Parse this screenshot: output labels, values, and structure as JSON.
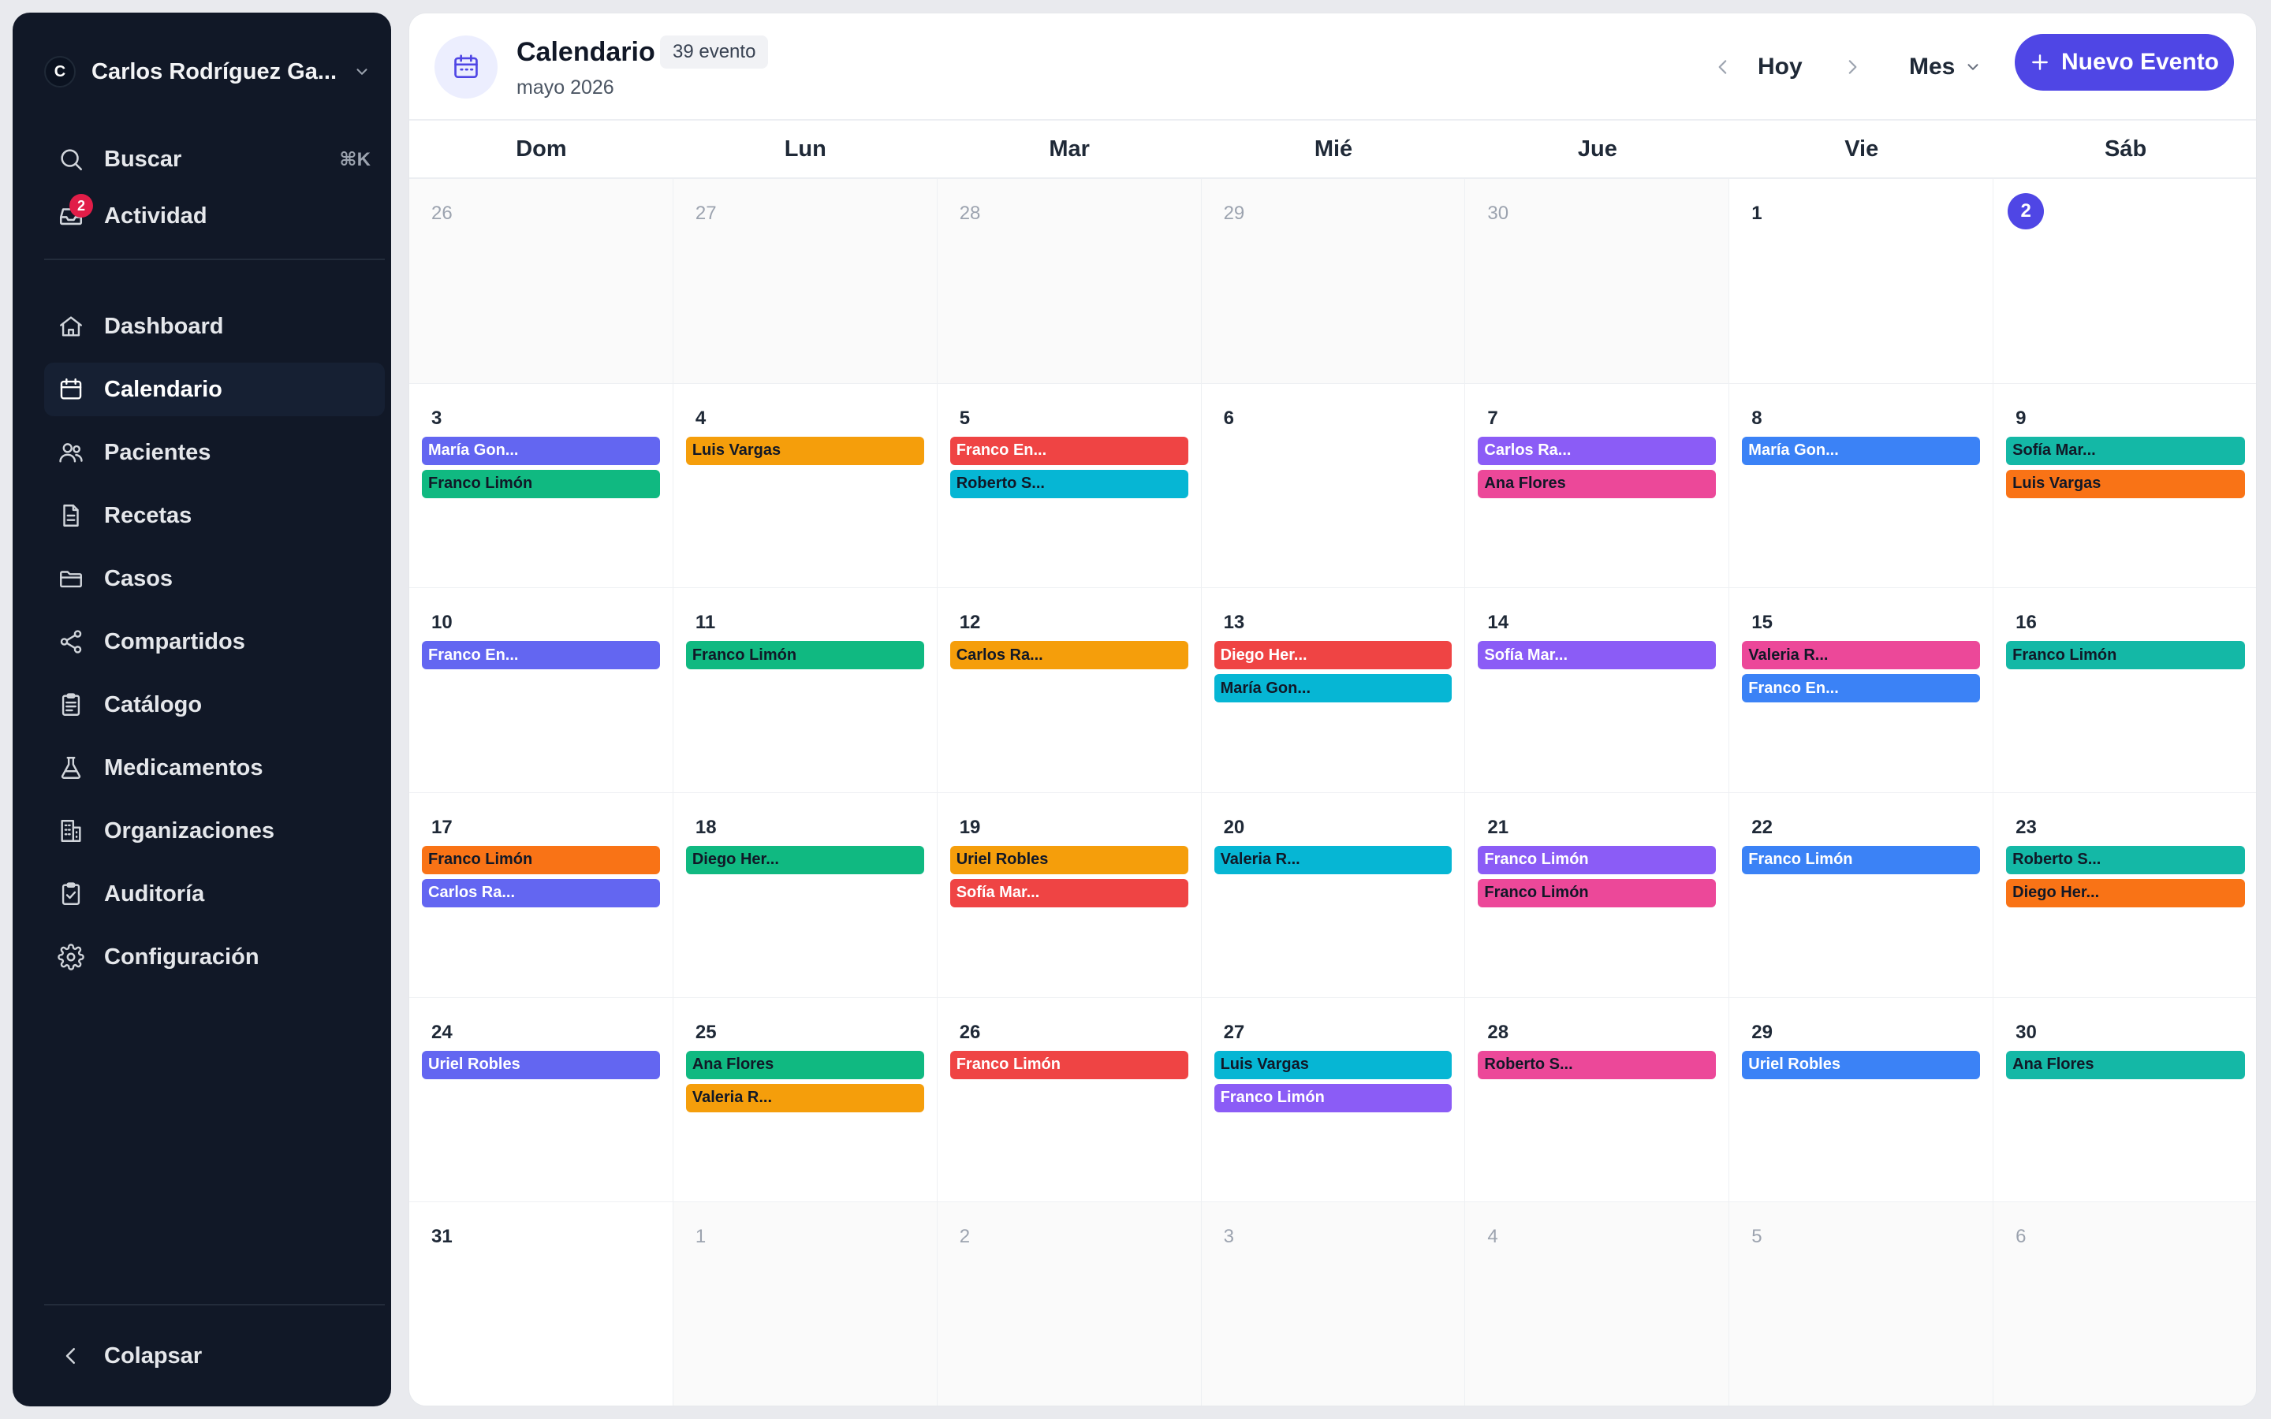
{
  "sidebar": {
    "user": {
      "initial": "C",
      "name": "Carlos Rodríguez Ga..."
    },
    "search": {
      "label": "Buscar",
      "shortcut": "⌘K"
    },
    "activity": {
      "label": "Actividad",
      "badge": "2"
    },
    "nav": [
      {
        "label": "Dashboard",
        "icon": "home-icon"
      },
      {
        "label": "Calendario",
        "icon": "calendar-icon",
        "active": true
      },
      {
        "label": "Pacientes",
        "icon": "users-icon"
      },
      {
        "label": "Recetas",
        "icon": "document-icon"
      },
      {
        "label": "Casos",
        "icon": "folder-icon"
      },
      {
        "label": "Compartidos",
        "icon": "share-icon"
      },
      {
        "label": "Catálogo",
        "icon": "clipboard-list-icon"
      },
      {
        "label": "Medicamentos",
        "icon": "flask-icon"
      },
      {
        "label": "Organizaciones",
        "icon": "building-icon"
      },
      {
        "label": "Auditoría",
        "icon": "clipboard-check-icon"
      },
      {
        "label": "Configuración",
        "icon": "gear-icon"
      }
    ],
    "collapse_label": "Colapsar"
  },
  "header": {
    "title": "Calendario",
    "count": "39 evento",
    "subtitle": "mayo 2026",
    "today_label": "Hoy",
    "view_label": "Mes",
    "new_event_label": "Nuevo Evento"
  },
  "colors": {
    "accent": "#4f46e5",
    "indigo": "#6366f1",
    "green": "#10b981",
    "amber": "#f59e0b",
    "red": "#ef4444",
    "cyan": "#06b6d4",
    "purple": "#8b5cf6",
    "blue": "#3b82f6",
    "teal": "#14b8a6",
    "orange": "#f97316",
    "pink": "#ec4899"
  },
  "weekdays": [
    "Dom",
    "Lun",
    "Mar",
    "Mié",
    "Jue",
    "Vie",
    "Sáb"
  ],
  "days": [
    {
      "num": "26",
      "other": true,
      "events": []
    },
    {
      "num": "27",
      "other": true,
      "events": []
    },
    {
      "num": "28",
      "other": true,
      "events": []
    },
    {
      "num": "29",
      "other": true,
      "events": []
    },
    {
      "num": "30",
      "other": true,
      "events": []
    },
    {
      "num": "1",
      "events": []
    },
    {
      "num": "2",
      "today": true,
      "events": []
    },
    {
      "num": "3",
      "events": [
        {
          "title": "María Gon...",
          "color": "indigo"
        },
        {
          "title": "Franco Limón",
          "color": "green"
        }
      ]
    },
    {
      "num": "4",
      "events": [
        {
          "title": "Luis Vargas",
          "color": "amber"
        }
      ]
    },
    {
      "num": "5",
      "events": [
        {
          "title": "Franco En...",
          "color": "red"
        },
        {
          "title": "Roberto S...",
          "color": "cyan"
        }
      ]
    },
    {
      "num": "6",
      "events": []
    },
    {
      "num": "7",
      "events": [
        {
          "title": "Carlos Ra...",
          "color": "purple"
        },
        {
          "title": "Ana Flores",
          "color": "pink"
        }
      ]
    },
    {
      "num": "8",
      "events": [
        {
          "title": "María Gon...",
          "color": "blue"
        }
      ]
    },
    {
      "num": "9",
      "events": [
        {
          "title": "Sofía Mar...",
          "color": "teal"
        },
        {
          "title": "Luis Vargas",
          "color": "orange"
        }
      ]
    },
    {
      "num": "10",
      "events": [
        {
          "title": "Franco En...",
          "color": "indigo"
        }
      ]
    },
    {
      "num": "11",
      "events": [
        {
          "title": "Franco Limón",
          "color": "green"
        }
      ]
    },
    {
      "num": "12",
      "events": [
        {
          "title": "Carlos Ra...",
          "color": "amber"
        }
      ]
    },
    {
      "num": "13",
      "events": [
        {
          "title": "Diego Her...",
          "color": "red"
        },
        {
          "title": "María Gon...",
          "color": "cyan"
        }
      ]
    },
    {
      "num": "14",
      "events": [
        {
          "title": "Sofía Mar...",
          "color": "purple"
        }
      ]
    },
    {
      "num": "15",
      "events": [
        {
          "title": "Valeria R...",
          "color": "pink"
        },
        {
          "title": "Franco En...",
          "color": "blue"
        }
      ]
    },
    {
      "num": "16",
      "events": [
        {
          "title": "Franco Limón",
          "color": "teal"
        }
      ]
    },
    {
      "num": "17",
      "events": [
        {
          "title": "Franco Limón",
          "color": "orange"
        },
        {
          "title": "Carlos Ra...",
          "color": "indigo"
        }
      ]
    },
    {
      "num": "18",
      "events": [
        {
          "title": "Diego Her...",
          "color": "green"
        }
      ]
    },
    {
      "num": "19",
      "events": [
        {
          "title": "Uriel Robles",
          "color": "amber"
        },
        {
          "title": "Sofía Mar...",
          "color": "red"
        }
      ]
    },
    {
      "num": "20",
      "events": [
        {
          "title": "Valeria R...",
          "color": "cyan"
        }
      ]
    },
    {
      "num": "21",
      "events": [
        {
          "title": "Franco Limón",
          "color": "purple"
        },
        {
          "title": "Franco Limón",
          "color": "pink"
        }
      ]
    },
    {
      "num": "22",
      "events": [
        {
          "title": "Franco Limón",
          "color": "blue"
        }
      ]
    },
    {
      "num": "23",
      "events": [
        {
          "title": "Roberto S...",
          "color": "teal"
        },
        {
          "title": "Diego Her...",
          "color": "orange"
        }
      ]
    },
    {
      "num": "24",
      "events": [
        {
          "title": "Uriel Robles",
          "color": "indigo"
        }
      ]
    },
    {
      "num": "25",
      "events": [
        {
          "title": "Ana Flores",
          "color": "green"
        },
        {
          "title": "Valeria R...",
          "color": "amber"
        }
      ]
    },
    {
      "num": "26",
      "events": [
        {
          "title": "Franco Limón",
          "color": "red"
        }
      ]
    },
    {
      "num": "27",
      "events": [
        {
          "title": "Luis Vargas",
          "color": "cyan"
        },
        {
          "title": "Franco Limón",
          "color": "purple"
        }
      ]
    },
    {
      "num": "28",
      "events": [
        {
          "title": "Roberto S...",
          "color": "pink"
        }
      ]
    },
    {
      "num": "29",
      "events": [
        {
          "title": "Uriel Robles",
          "color": "blue"
        }
      ]
    },
    {
      "num": "30",
      "events": [
        {
          "title": "Ana Flores",
          "color": "teal"
        }
      ]
    },
    {
      "num": "31",
      "events": []
    },
    {
      "num": "1",
      "other": true,
      "events": []
    },
    {
      "num": "2",
      "other": true,
      "events": []
    },
    {
      "num": "3",
      "other": true,
      "events": []
    },
    {
      "num": "4",
      "other": true,
      "events": []
    },
    {
      "num": "5",
      "other": true,
      "events": []
    },
    {
      "num": "6",
      "other": true,
      "events": []
    }
  ]
}
